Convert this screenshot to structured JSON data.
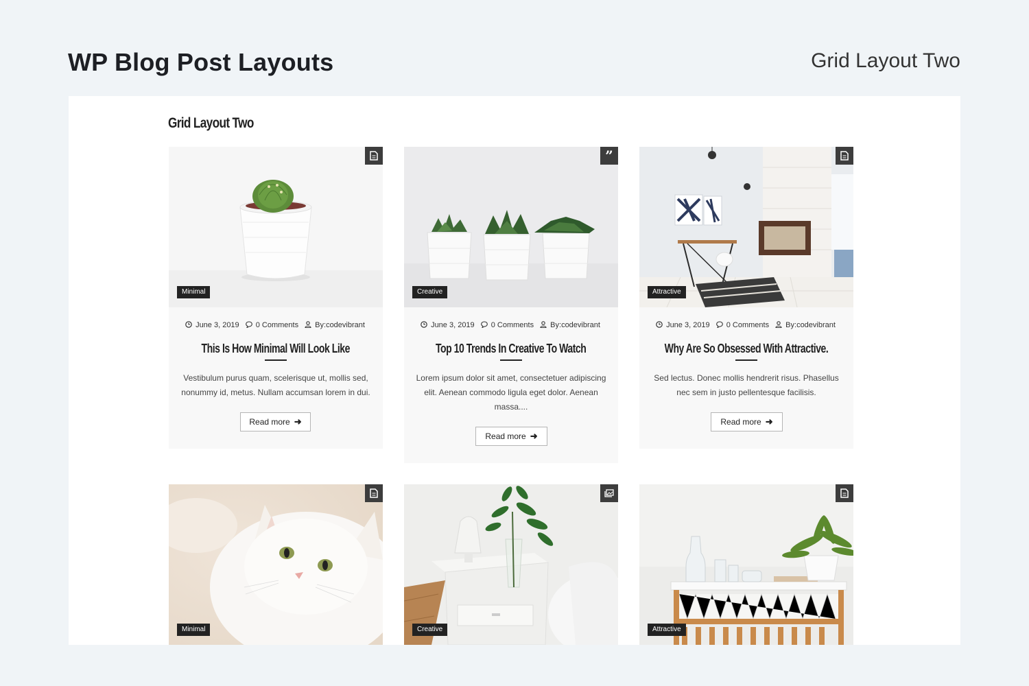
{
  "page": {
    "title": "WP Blog Post Layouts",
    "subtitle": "Grid Layout Two"
  },
  "section": {
    "title": "Grid Layout Two"
  },
  "read_more_label": "Read more",
  "posts": [
    {
      "category": "Minimal",
      "format_icon": "document-icon",
      "date": "June 3, 2019",
      "comments": "0 Comments",
      "author": "By:codevibrant",
      "title": "This Is How Minimal Will Look Like",
      "excerpt": "Vestibulum purus quam, scelerisque ut, mollis sed, nonummy id, metus. Nullam accumsan lorem in dui.",
      "image": "cactus in white pot"
    },
    {
      "category": "Creative",
      "format_icon": "quote-icon",
      "date": "June 3, 2019",
      "comments": "0 Comments",
      "author": "By:codevibrant",
      "title": "Top 10 Trends In Creative To Watch",
      "excerpt": "Lorem ipsum dolor sit amet, consectetuer adipiscing elit. Aenean commodo ligula eget dolor. Aenean massa....",
      "image": "three succulents in white pots"
    },
    {
      "category": "Attractive",
      "format_icon": "document-icon",
      "date": "June 3, 2019",
      "comments": "0 Comments",
      "author": "By:codevibrant",
      "title": "Why Are So Obsessed With Attractive.",
      "excerpt": "Sed lectus. Donec mollis hendrerit risus. Phasellus nec sem in justo pellentesque facilisis.",
      "image": "bright room with fireplace and desk"
    },
    {
      "category": "Minimal",
      "format_icon": "document-icon",
      "image": "white cat with green eyes"
    },
    {
      "category": "Creative",
      "format_icon": "gallery-icon",
      "image": "bedside table with lamp and plant"
    },
    {
      "category": "Attractive",
      "format_icon": "document-icon",
      "image": "wooden console table with fern"
    }
  ],
  "colors": {
    "background": "#f0f4f7",
    "panel": "#ffffff",
    "card": "#f8f8f8",
    "badge": "#222222",
    "format_icon_bg": "#3d3d3d"
  }
}
